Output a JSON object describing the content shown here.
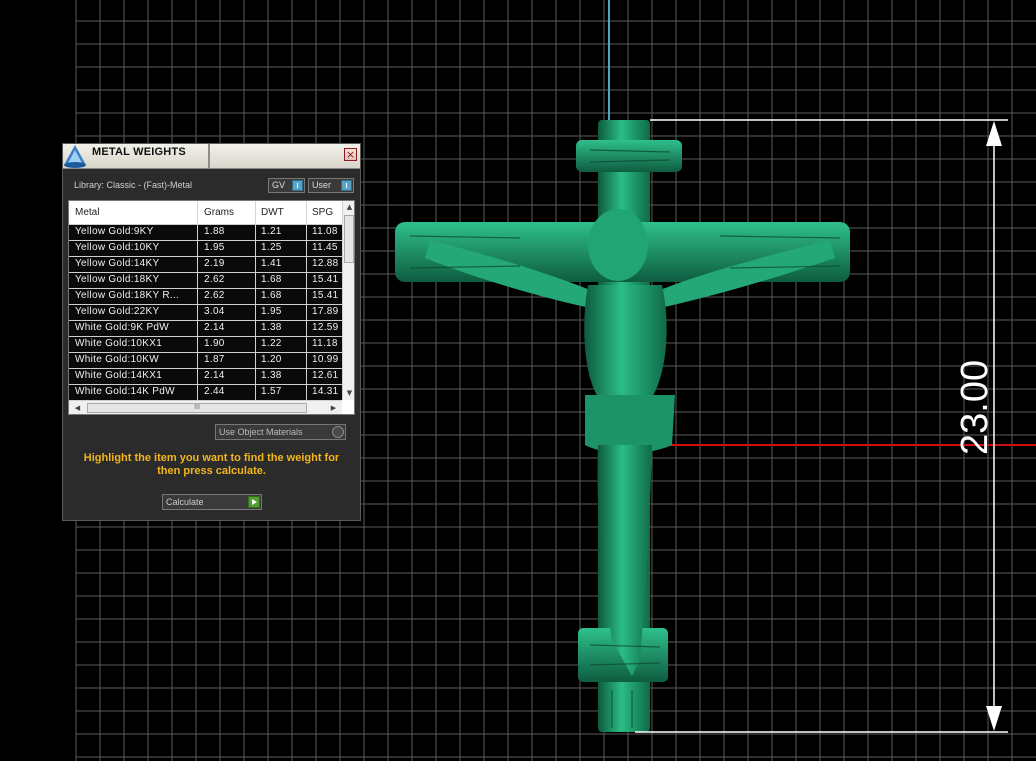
{
  "dialog": {
    "title": "METAL WEIGHTS",
    "close_glyph": "×",
    "library_label": "Library: Classic - (Fast)-Metal",
    "toggle_gv": "GV",
    "toggle_user": "User",
    "columns": [
      "Metal",
      "Grams",
      "DWT",
      "SPG"
    ],
    "rows": [
      [
        "Yellow Gold:9KY",
        "1.88",
        "1.21",
        "11.08"
      ],
      [
        "Yellow Gold:10KY",
        "1.95",
        "1.25",
        "11.45"
      ],
      [
        "Yellow Gold:14KY",
        "2.19",
        "1.41",
        "12.88"
      ],
      [
        "Yellow Gold:18KY",
        "2.62",
        "1.68",
        "15.41"
      ],
      [
        "Yellow Gold:18KY R...",
        "2.62",
        "1.68",
        "15.41"
      ],
      [
        "Yellow Gold:22KY",
        "3.04",
        "1.95",
        "17.89"
      ],
      [
        "White Gold:9K PdW",
        "2.14",
        "1.38",
        "12.59"
      ],
      [
        "White Gold:10KX1",
        "1.90",
        "1.22",
        "11.18"
      ],
      [
        "White Gold:10KW",
        "1.87",
        "1.20",
        "10.99"
      ],
      [
        "White Gold:14KX1",
        "2.14",
        "1.38",
        "12.61"
      ],
      [
        "White Gold:14K PdW",
        "2.44",
        "1.57",
        "14.31"
      ]
    ],
    "scroll_up_glyph": "▲",
    "scroll_down_glyph": "▼",
    "scroll_left_glyph": "◀",
    "scroll_right_glyph": "▶",
    "hthumb_grip": "III",
    "materials_select": "Use Object Materials",
    "hint": "Highlight the item you want to find the weight for then press calculate.",
    "calculate_button": "Calculate"
  },
  "viewport": {
    "dimension_value": "23.00",
    "model": "crucifix",
    "model_color": "#1f9e6e",
    "background_color": "#000000",
    "grid_color": "#5a5a5a",
    "axis_x_color": "#d01010",
    "axis_y_color": "#4aa8c0"
  }
}
